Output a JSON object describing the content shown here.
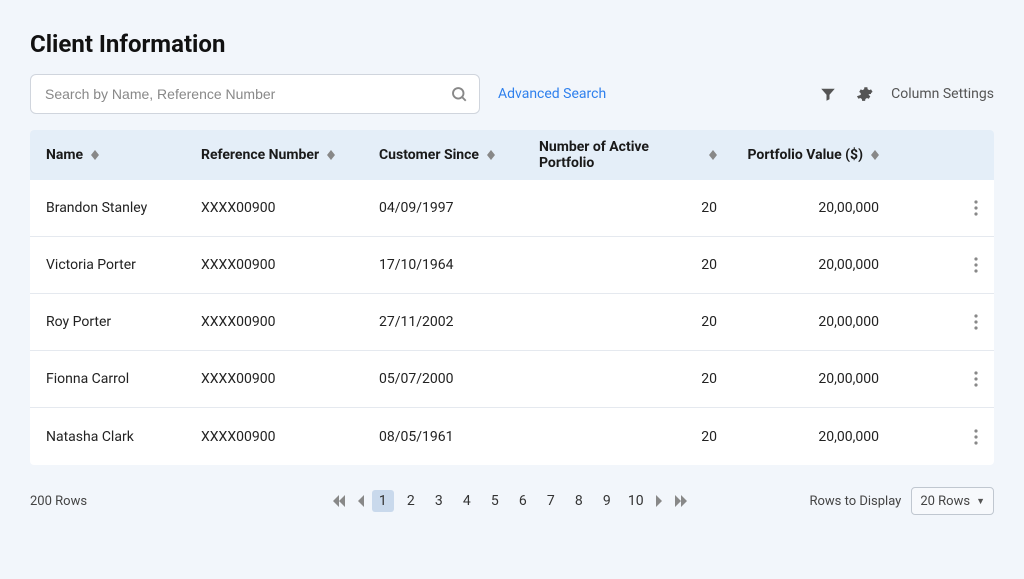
{
  "page": {
    "title": "Client Information"
  },
  "search": {
    "placeholder": "Search by Name, Reference Number",
    "value": ""
  },
  "links": {
    "advanced_search": "Advanced Search",
    "column_settings": "Column Settings"
  },
  "table": {
    "columns": {
      "name": "Name",
      "ref": "Reference Number",
      "since": "Customer Since",
      "active": "Number of Active Portfolio",
      "value": "Portfolio Value ($)"
    },
    "rows": [
      {
        "name": "Brandon Stanley",
        "ref": "XXXX00900",
        "since": "04/09/1997",
        "active": "20",
        "value": "20,00,000"
      },
      {
        "name": "Victoria Porter",
        "ref": "XXXX00900",
        "since": "17/10/1964",
        "active": "20",
        "value": "20,00,000"
      },
      {
        "name": "Roy Porter",
        "ref": "XXXX00900",
        "since": "27/11/2002",
        "active": "20",
        "value": "20,00,000"
      },
      {
        "name": "Fionna Carrol",
        "ref": "XXXX00900",
        "since": "05/07/2000",
        "active": "20",
        "value": "20,00,000"
      },
      {
        "name": "Natasha Clark",
        "ref": "XXXX00900",
        "since": "08/05/1961",
        "active": "20",
        "value": "20,00,000"
      }
    ]
  },
  "pagination": {
    "total_rows": "200 Rows",
    "pages": [
      "1",
      "2",
      "3",
      "4",
      "5",
      "6",
      "7",
      "8",
      "9",
      "10"
    ],
    "current": 1,
    "rows_to_display_label": "Rows to Display",
    "rows_to_display_value": "20 Rows"
  }
}
